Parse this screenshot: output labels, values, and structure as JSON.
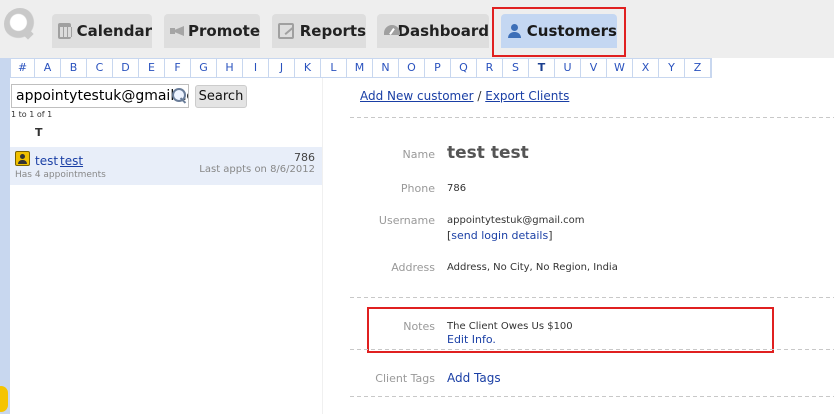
{
  "nav": {
    "tabs": [
      {
        "label": "Calendar",
        "icon": "calendar-icon"
      },
      {
        "label": "Promote",
        "icon": "megaphone-icon"
      },
      {
        "label": "Reports",
        "icon": "edit-report-icon"
      },
      {
        "label": "Dashboard",
        "icon": "gauge-icon"
      },
      {
        "label": "Customers",
        "icon": "users-icon",
        "active": true
      }
    ],
    "active_color": "#c4d7f2",
    "highlight_color": "#e02020"
  },
  "alphabet": [
    "#",
    "A",
    "B",
    "C",
    "D",
    "E",
    "F",
    "G",
    "H",
    "I",
    "J",
    "K",
    "L",
    "M",
    "N",
    "O",
    "P",
    "Q",
    "R",
    "S",
    "T",
    "U",
    "V",
    "W",
    "X",
    "Y",
    "Z"
  ],
  "alphabet_active": "T",
  "search": {
    "value": "appointytestuk@gmail.com",
    "button_label": "Search"
  },
  "results": {
    "count_text": "1 to 1 of 1",
    "group_letter": "T",
    "items": [
      {
        "first_name": "test",
        "last_name": "test",
        "phone": "786",
        "appointments_text": "Has 4 appointments",
        "last_appt_text": "Last appts on 8/6/2012"
      }
    ]
  },
  "actions": {
    "add_new": "Add New customer",
    "separator": "/",
    "export": "Export Clients"
  },
  "detail": {
    "name_label": "Name",
    "name_value": "test test",
    "phone_label": "Phone",
    "phone_value": "786",
    "username_label": "Username",
    "username_value": "appointytestuk@gmail.com",
    "send_login_open": "[",
    "send_login": "send login details",
    "send_login_close": "]",
    "address_label": "Address",
    "address_value": "Address, No City, No Region, India",
    "notes_label": "Notes",
    "notes_value": "The Client Owes Us $100",
    "edit_info": "Edit Info.",
    "tags_label": "Client Tags",
    "add_tags": "Add Tags"
  }
}
